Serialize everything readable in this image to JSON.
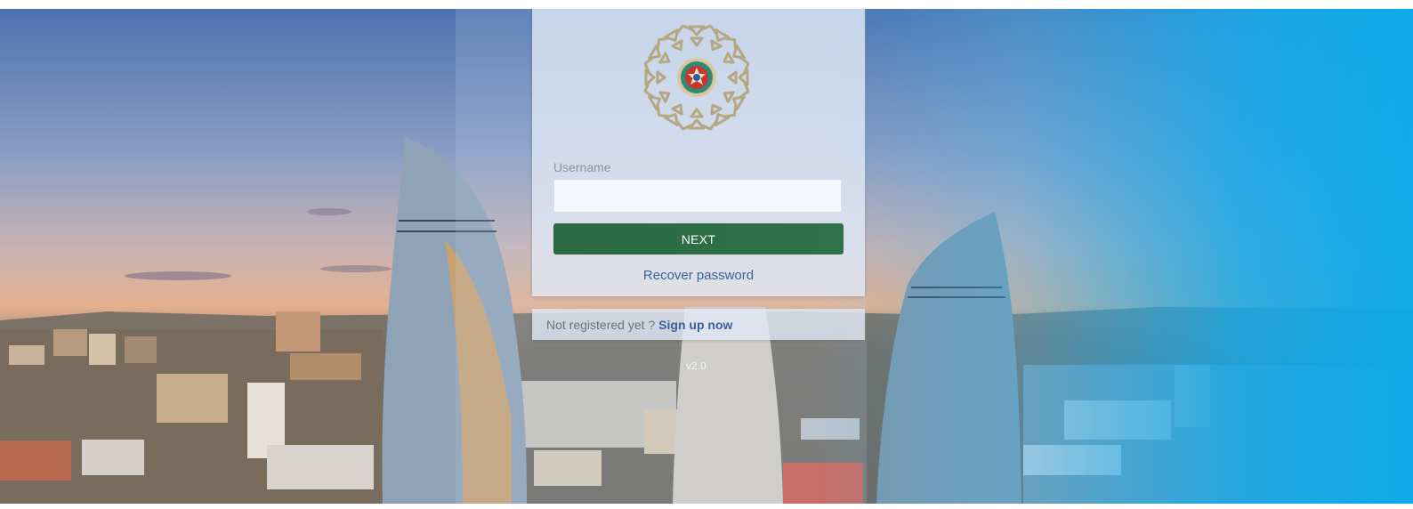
{
  "login": {
    "username_label": "Username",
    "username_value": "",
    "username_placeholder": "",
    "next_label": "NEXT",
    "recover_label": "Recover password"
  },
  "register": {
    "prompt": "Not registered yet ?",
    "signup_label": "Sign up now"
  },
  "version": "v2.0",
  "colors": {
    "button_green": "#2b6a42",
    "link_blue": "#37629e",
    "emblem_gold": "#b5a782"
  },
  "icons": {
    "emblem": "azerbaijan-emblem-icon"
  }
}
